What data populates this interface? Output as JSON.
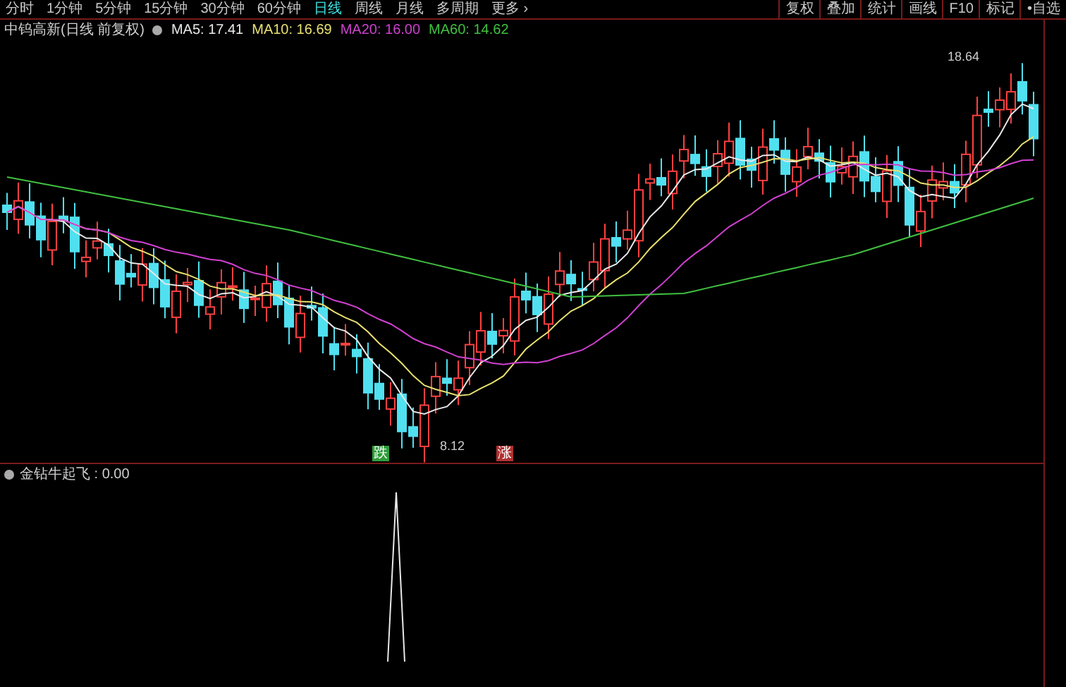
{
  "toolbar": {
    "periods": [
      {
        "label": "分时",
        "selected": false
      },
      {
        "label": "1分钟",
        "selected": false
      },
      {
        "label": "5分钟",
        "selected": false
      },
      {
        "label": "15分钟",
        "selected": false
      },
      {
        "label": "30分钟",
        "selected": false
      },
      {
        "label": "60分钟",
        "selected": false
      },
      {
        "label": "日线",
        "selected": true
      },
      {
        "label": "周线",
        "selected": false
      },
      {
        "label": "月线",
        "selected": false
      },
      {
        "label": "多周期",
        "selected": false
      },
      {
        "label": "更多 ›",
        "selected": false
      }
    ],
    "tools": [
      "复权",
      "叠加",
      "统计",
      "画线",
      "F10",
      "标记",
      "•自选"
    ]
  },
  "main_pane": {
    "title": "中钨高新(日线 前复权)",
    "indicators": [
      {
        "label": "MA5: 17.41",
        "color": "#e8e8e8"
      },
      {
        "label": "MA10: 16.69",
        "color": "#e8e070"
      },
      {
        "label": "MA20: 16.00",
        "color": "#d040d0"
      },
      {
        "label": "MA60: 14.62",
        "color": "#40c040"
      }
    ],
    "high_label": "18.64",
    "low_label": "8.12",
    "signals": [
      {
        "label": "跌",
        "color": "#2e9c3a"
      },
      {
        "label": "涨",
        "color": "#b03030"
      }
    ]
  },
  "sub_pane": {
    "title": "金钻牛起飞 : 0.00"
  }
}
